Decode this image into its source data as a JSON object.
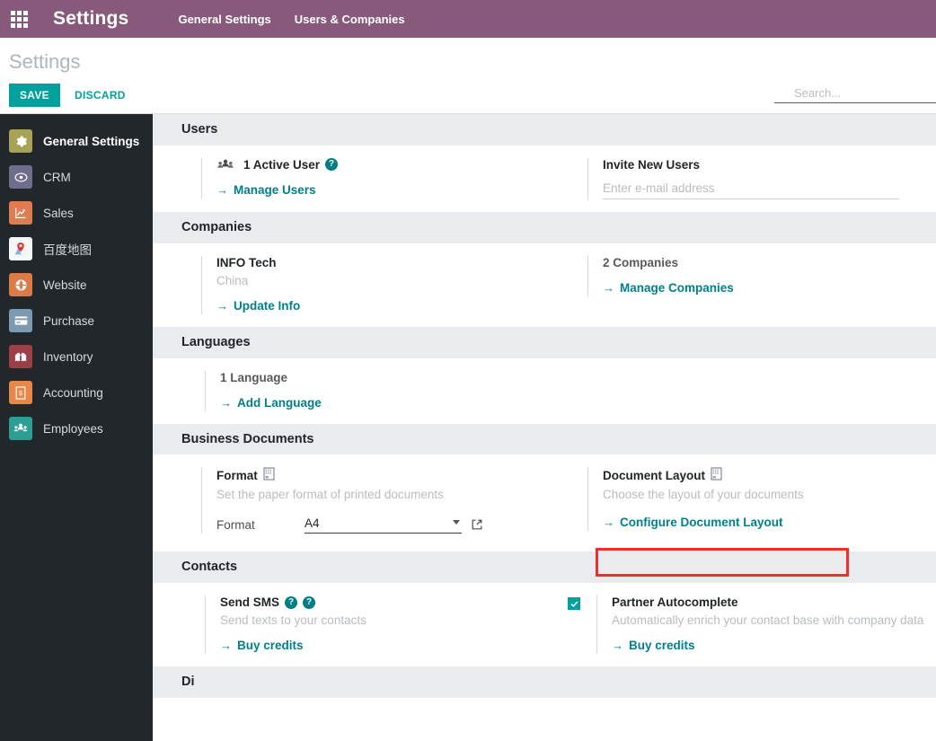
{
  "topbar": {
    "apps_icon": "apps-grid-icon",
    "brand": "Settings",
    "menu": [
      {
        "label": "General Settings"
      },
      {
        "label": "Users & Companies"
      }
    ],
    "brand_color": "#875A7B"
  },
  "control_panel": {
    "title": "Settings",
    "save_label": "SAVE",
    "discard_label": "DISCARD",
    "save_color": "#00A09D",
    "search": {
      "placeholder": "Search...",
      "value": "",
      "icon": "search-icon"
    }
  },
  "sidebar": {
    "background": "#22272B",
    "items": [
      {
        "label": "General Settings",
        "icon": "gear-icon",
        "icon_bg": "#A6A257",
        "glyph": "⚙",
        "active": true
      },
      {
        "label": "CRM",
        "icon": "crm-icon",
        "icon_bg": "#6E6E8C",
        "glyph": "☺",
        "active": false
      },
      {
        "label": "Sales",
        "icon": "chart-up-icon",
        "icon_bg": "#E07B52",
        "glyph": "↗",
        "active": false
      },
      {
        "label": "百度地图",
        "icon": "map-pin-icon",
        "icon_bg": "#F2F2F2",
        "glyph": "●",
        "active": false
      },
      {
        "label": "Website",
        "icon": "globe-icon",
        "icon_bg": "#DB7C48",
        "glyph": "◔",
        "active": false
      },
      {
        "label": "Purchase",
        "icon": "card-icon",
        "icon_bg": "#7C9BB0",
        "glyph": "▤",
        "active": false
      },
      {
        "label": "Inventory",
        "icon": "box-icon",
        "icon_bg": "#9C3F47",
        "glyph": "✉",
        "active": false
      },
      {
        "label": "Accounting",
        "icon": "invoice-icon",
        "icon_bg": "#E5884A",
        "glyph": "▧",
        "active": false
      },
      {
        "label": "Employees",
        "icon": "people-icon",
        "icon_bg": "#2E9E94",
        "glyph": "♟",
        "active": false
      }
    ]
  },
  "sections": {
    "users": {
      "heading": "Users",
      "left": {
        "icon": "users-group-icon",
        "title": "1 Active User",
        "help_icon": "question-mark-icon",
        "link": "Manage Users",
        "link_arrow": "→"
      },
      "right": {
        "title": "Invite New Users",
        "input_placeholder": "Enter e-mail address",
        "input_value": ""
      }
    },
    "companies": {
      "heading": "Companies",
      "left": {
        "title": "INFO Tech",
        "desc": "China",
        "link": "Update Info",
        "link_arrow": "→"
      },
      "right": {
        "title": "2 Companies",
        "link": "Manage Companies",
        "link_arrow": "→"
      }
    },
    "languages": {
      "heading": "Languages",
      "left": {
        "title": "1 Language",
        "link": "Add Language",
        "link_arrow": "→"
      }
    },
    "business_documents": {
      "heading": "Business Documents",
      "left": {
        "title": "Format",
        "title_icon": "document-icon",
        "desc": "Set the paper format of printed documents",
        "field_label": "Format",
        "field_value": "A4",
        "external_link_icon": "external-link-icon"
      },
      "right": {
        "title": "Document Layout",
        "title_icon": "document-icon",
        "desc": "Choose the layout of your documents",
        "link": "Configure Document Layout",
        "link_arrow": "→",
        "highlight_color": "#F32C2C"
      }
    },
    "contacts": {
      "heading": "Contacts",
      "left": {
        "title": "Send SMS",
        "help_icons": [
          "question-mark-icon",
          "question-mark-icon"
        ],
        "desc": "Send texts to your contacts",
        "link": "Buy credits",
        "link_arrow": "→"
      },
      "right": {
        "checked": true,
        "checkbox_color": "#00A09D",
        "title": "Partner Autocomplete",
        "desc": "Automatically enrich your contact base with company data",
        "link": "Buy credits",
        "link_arrow": "→"
      }
    },
    "next_partial": {
      "heading": "Di"
    }
  }
}
